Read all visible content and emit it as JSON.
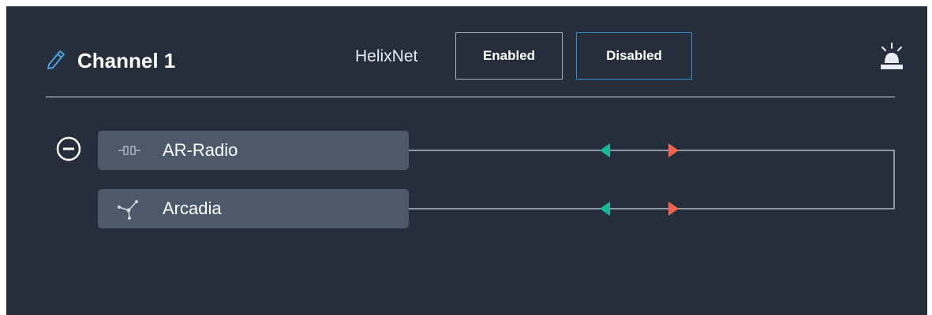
{
  "channel": {
    "title": "Channel 1",
    "title_icon": "pencil-icon",
    "helixnet_label": "HelixNet",
    "enabled_label": "Enabled",
    "disabled_label": "Disabled",
    "selected_mode": "Disabled",
    "alarm_icon": "alarm-light-icon"
  },
  "ports": [
    {
      "label": "AR-Radio",
      "icon": "radio-port-icon"
    },
    {
      "label": "Arcadia",
      "icon": "network-node-icon"
    }
  ],
  "colors": {
    "background": "#262e3b",
    "port_background": "#4b596b",
    "selected_border": "#2f8fd0",
    "talk_arrow": "#18b89a",
    "listen_arrow": "#f0644f"
  }
}
